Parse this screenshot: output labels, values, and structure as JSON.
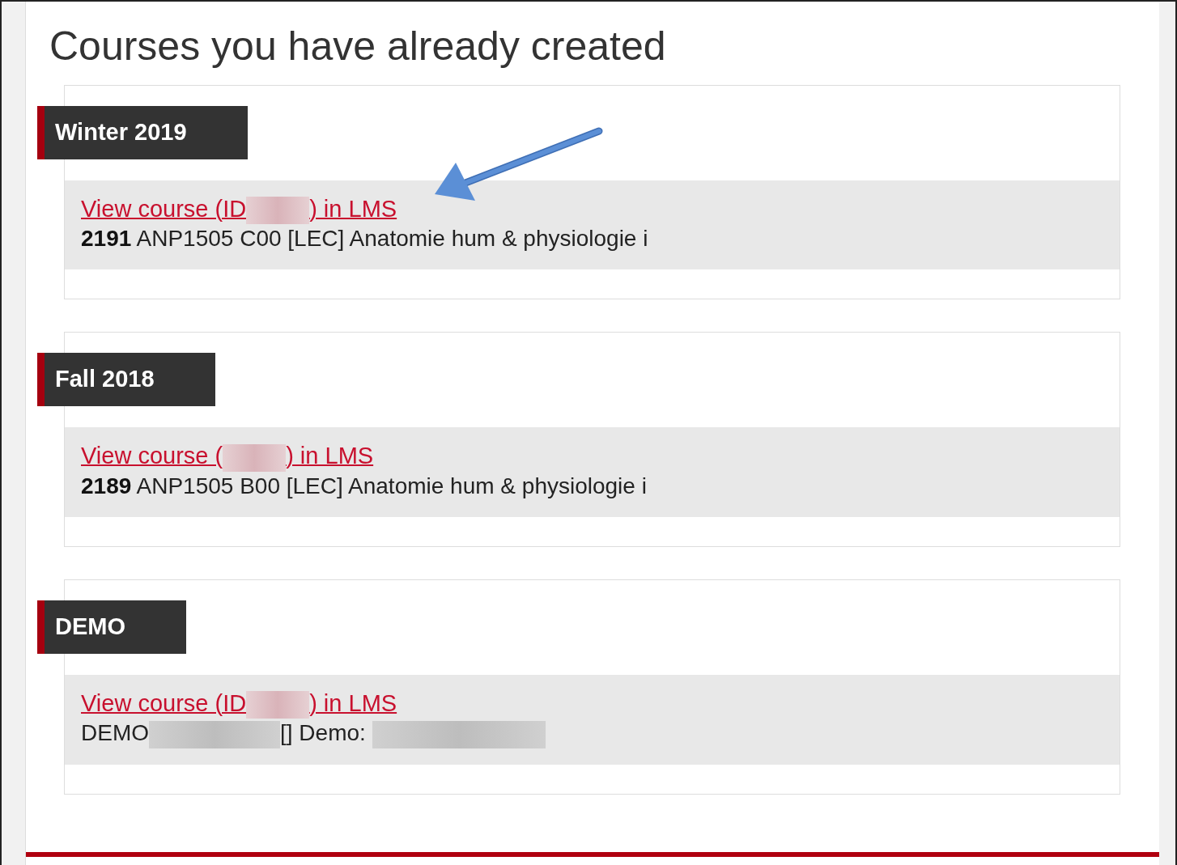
{
  "heading": "Courses you have already created",
  "terms": [
    {
      "title": "Winter 2019",
      "link": {
        "before": "View course (ID",
        "after": ") in LMS"
      },
      "details": [
        {
          "kind": "text",
          "text": "**2191** ANP1505 C00 [LEC] Anatomie hum & physiologie i"
        }
      ]
    },
    {
      "title": "Fall 2018",
      "link": {
        "before": "View course (",
        "after": ") in LMS"
      },
      "details": [
        {
          "kind": "text",
          "text": "**2189** ANP1505 B00 [LEC] Anatomie hum & physiologie i"
        }
      ]
    },
    {
      "title": "DEMO",
      "link": {
        "before": "View course (ID",
        "after": ") in LMS"
      },
      "details": [
        {
          "kind": "text",
          "text": "DEMO"
        },
        {
          "kind": "redacted"
        },
        {
          "kind": "text",
          "text": "[] Demo: "
        },
        {
          "kind": "redacted"
        }
      ]
    }
  ]
}
